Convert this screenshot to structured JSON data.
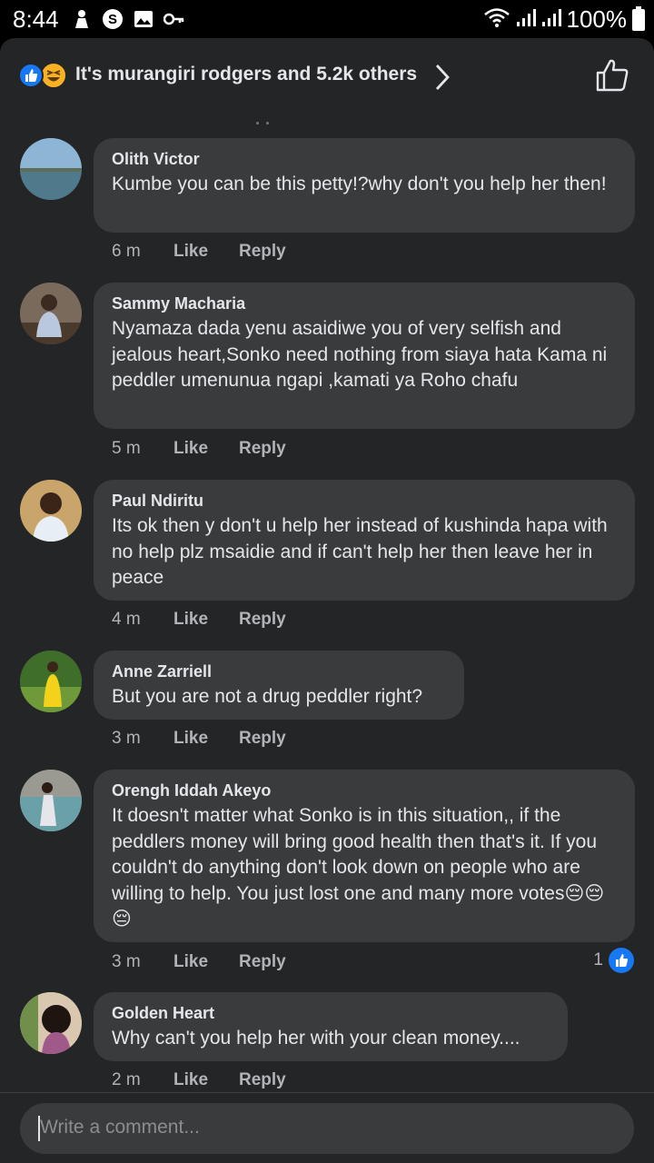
{
  "status_bar": {
    "time": "8:44",
    "battery": "100%",
    "left_icons": [
      "person-icon",
      "s-badge-icon",
      "image-icon",
      "key-icon"
    ],
    "right_icons": [
      "wifi-icon",
      "signal-icon",
      "signal-icon",
      "battery-icon"
    ]
  },
  "reaction_bar": {
    "summary": "It's murangiri rodgers and 5.2k others",
    "reactions": [
      "like",
      "haha"
    ]
  },
  "comments": [
    {
      "name": "Olith Victor",
      "text": "Kumbe you can be this petty!?why don't you help her then!",
      "time": "6 m",
      "like": "Like",
      "reply": "Reply"
    },
    {
      "name": "Sammy Macharia",
      "text": "Nyamaza dada yenu asaidiwe you of very selfish and jealous heart,Sonko need nothing from siaya hata Kama ni peddler umenunua ngapi ,kamati ya Roho chafu",
      "time": "5 m",
      "like": "Like",
      "reply": "Reply"
    },
    {
      "name": "Paul Ndiritu",
      "text": "Its ok then y don't u help her instead of kushinda hapa with no help plz msaidie and if can't help her then leave her in peace",
      "time": "4 m",
      "like": "Like",
      "reply": "Reply"
    },
    {
      "name": "Anne Zarriell",
      "text": "But you are not a drug peddler right?",
      "time": "3 m",
      "like": "Like",
      "reply": "Reply"
    },
    {
      "name": "Orengh Iddah Akeyo",
      "text": "It doesn't matter what Sonko is in this situation,, if the peddlers money will bring good health then that's it. If you couldn't do anything don't look down on people who are willing to help. You just lost one and many more votes😔😔😔",
      "time": "3 m",
      "like": "Like",
      "reply": "Reply",
      "like_count": "1"
    },
    {
      "name": "Golden Heart",
      "text": "Why can't you help her with your clean money....",
      "time": "2 m",
      "like": "Like",
      "reply": "Reply"
    }
  ],
  "composer": {
    "placeholder": "Write a comment..."
  }
}
